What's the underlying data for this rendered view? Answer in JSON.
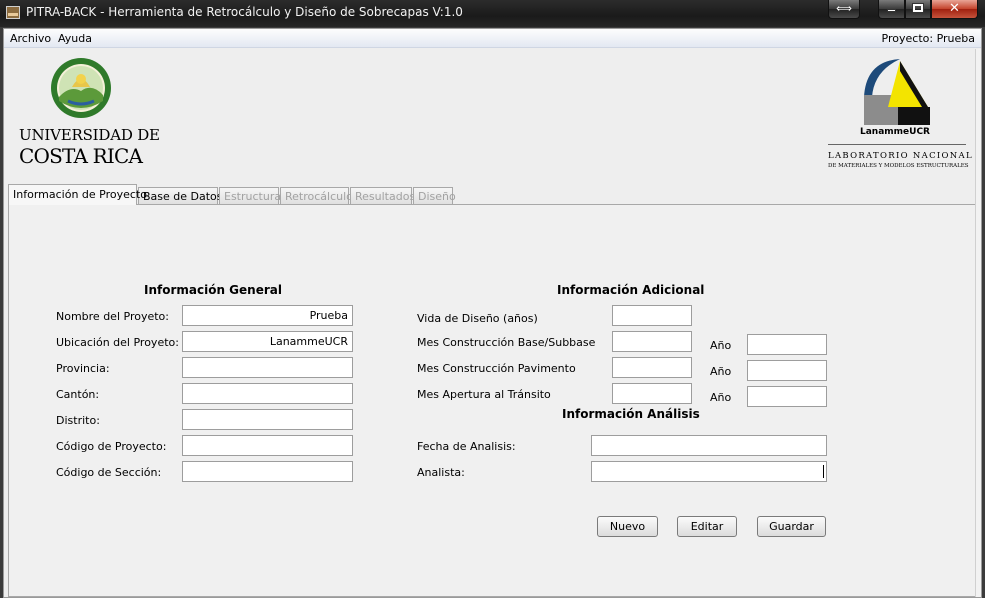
{
  "window": {
    "title": "PITRA-BACK - Herramienta de Retrocálculo y Diseño de Sobrecapas V:1.0",
    "resize_glyph": "⟺",
    "close_glyph": "✕"
  },
  "menubar": {
    "items": [
      "Archivo",
      "Ayuda"
    ],
    "project_text": "Proyecto: Prueba"
  },
  "logos": {
    "ucr_line1": "UNIVERSIDAD DE",
    "ucr_line2": "COSTA RICA",
    "lanamme_name": "LanammeUCR",
    "lanamme_lab": "LABORATORIO NACIONAL",
    "lanamme_sub": "DE MATERIALES Y MODELOS ESTRUCTURALES"
  },
  "tabs": [
    {
      "label": "Información de Proyecto",
      "state": "active"
    },
    {
      "label": "Base de Datos",
      "state": "enabled"
    },
    {
      "label": "Estructura",
      "state": "disabled"
    },
    {
      "label": "Retrocálculo",
      "state": "disabled"
    },
    {
      "label": "Resultados",
      "state": "disabled"
    },
    {
      "label": "Diseño",
      "state": "disabled"
    }
  ],
  "general": {
    "title": "Información General",
    "nombre_label": "Nombre del Proyeto:",
    "nombre_value": "Prueba",
    "ubicacion_label": "Ubicación del Proyeto:",
    "ubicacion_value": "LanammeUCR",
    "provincia_label": "Provincia:",
    "provincia_value": "",
    "canton_label": "Cantón:",
    "canton_value": "",
    "distrito_label": "Distrito:",
    "distrito_value": "",
    "codigo_proyecto_label": "Código de Proyecto:",
    "codigo_proyecto_value": "",
    "codigo_seccion_label": "Código de Sección:",
    "codigo_seccion_value": ""
  },
  "adicional": {
    "title": "Información Adicional",
    "vida_label": "Vida de Diseño (años)",
    "vida_value": "",
    "mes_base_label": "Mes Construcción Base/Subbase",
    "mes_base_value": "",
    "mes_pav_label": "Mes Construcción Pavimento",
    "mes_pav_value": "",
    "mes_apertura_label": "Mes Apertura al Tránsito",
    "mes_apertura_value": "",
    "anio_label": "Año",
    "anio_base_value": "",
    "anio_pav_value": "",
    "anio_apertura_value": ""
  },
  "analisis": {
    "title": "Información Análisis",
    "fecha_label": "Fecha de Analisis:",
    "fecha_value": "",
    "analista_label": "Analista:",
    "analista_value": ""
  },
  "actions": {
    "nuevo": "Nuevo",
    "editar": "Editar",
    "guardar": "Guardar"
  },
  "colors": {
    "accent_green": "#3f8e2f",
    "lanamme_blue": "#1d4a7a",
    "lanamme_yellow": "#f3e400",
    "close_red": "#c3412a"
  }
}
